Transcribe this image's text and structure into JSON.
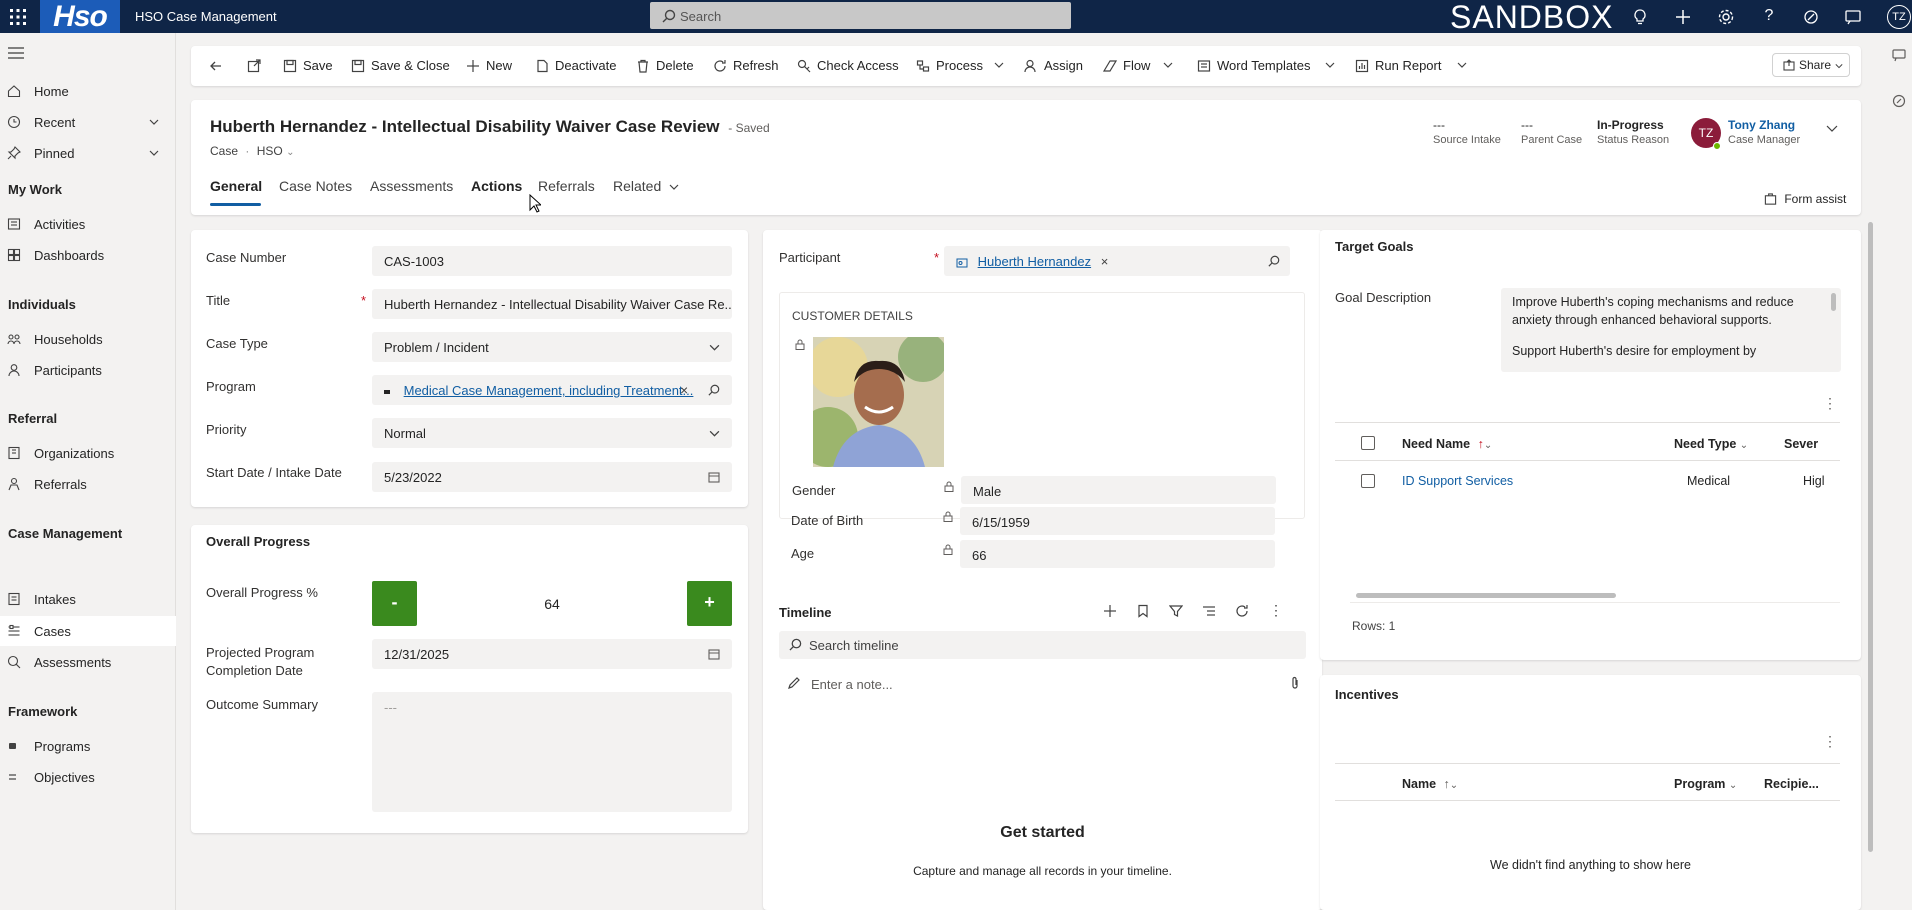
{
  "topbar": {
    "logo": "Hso",
    "app_name": "HSO Case Management",
    "search_placeholder": "Search",
    "environment": "SANDBOX",
    "avatar": "TZ"
  },
  "sidebar": {
    "items_top": [
      {
        "label": "Home",
        "icon": "home-icon"
      },
      {
        "label": "Recent",
        "icon": "clock-icon"
      },
      {
        "label": "Pinned",
        "icon": "pin-icon"
      }
    ],
    "sections": [
      {
        "title": "My Work",
        "items": [
          {
            "label": "Activities",
            "icon": "activities-icon"
          },
          {
            "label": "Dashboards",
            "icon": "dashboard-icon"
          }
        ]
      },
      {
        "title": "Individuals",
        "items": [
          {
            "label": "Households",
            "icon": "households-icon"
          },
          {
            "label": "Participants",
            "icon": "person-icon"
          }
        ]
      },
      {
        "title": "Referral",
        "items": [
          {
            "label": "Organizations",
            "icon": "organizations-icon"
          },
          {
            "label": "Referrals",
            "icon": "referrals-icon"
          }
        ]
      },
      {
        "title": "Case Management",
        "items": [
          {
            "label": "Intakes",
            "icon": "intakes-icon"
          },
          {
            "label": "Cases",
            "icon": "cases-icon"
          },
          {
            "label": "Assessments",
            "icon": "assessments-icon"
          }
        ]
      },
      {
        "title": "Framework",
        "items": [
          {
            "label": "Programs",
            "icon": "programs-icon"
          },
          {
            "label": "Objectives",
            "icon": "objectives-icon"
          }
        ]
      }
    ]
  },
  "commandbar": {
    "save": "Save",
    "save_close": "Save & Close",
    "new": "New",
    "deactivate": "Deactivate",
    "delete": "Delete",
    "refresh": "Refresh",
    "check_access": "Check Access",
    "process": "Process",
    "assign": "Assign",
    "flow": "Flow",
    "word_templates": "Word Templates",
    "run_report": "Run Report",
    "share": "Share"
  },
  "header": {
    "title": "Huberth Hernandez - Intellectual Disability Waiver Case Review",
    "save_status": "- Saved",
    "entity": "Case",
    "form": "HSO",
    "source_intake_value": "---",
    "source_intake_label": "Source Intake",
    "parent_case_value": "---",
    "parent_case_label": "Parent Case",
    "status_reason_value": "In-Progress",
    "status_reason_label": "Status Reason",
    "owner_initials": "TZ",
    "owner_name": "Tony Zhang",
    "owner_role": "Case Manager",
    "tabs": [
      "General",
      "Case Notes",
      "Assessments",
      "Actions",
      "Referrals",
      "Related"
    ],
    "form_assist": "Form assist"
  },
  "case_fields": {
    "case_number_label": "Case Number",
    "case_number": "CAS-1003",
    "title_label": "Title",
    "title": "Huberth Hernandez - Intellectual Disability Waiver Case Re...",
    "case_type_label": "Case Type",
    "case_type": "Problem / Incident",
    "program_label": "Program",
    "program": "Medical Case Management, including Treatment...",
    "priority_label": "Priority",
    "priority": "Normal",
    "start_date_label": "Start Date / Intake Date",
    "start_date": "5/23/2022"
  },
  "progress": {
    "section_title": "Overall Progress",
    "percent_label": "Overall Progress %",
    "minus": "-",
    "plus": "+",
    "value": "64",
    "projected_label_1": "Projected Program",
    "projected_label_2": "Completion Date",
    "projected_date": "12/31/2025",
    "outcome_label": "Outcome Summary",
    "outcome_placeholder": "---"
  },
  "participant": {
    "label": "Participant",
    "value": "Huberth Hernandez",
    "customer_details": "CUSTOMER DETAILS",
    "gender_label": "Gender",
    "gender": "Male",
    "dob_label": "Date of Birth",
    "dob": "6/15/1959",
    "age_label": "Age",
    "age": "66"
  },
  "timeline": {
    "title": "Timeline",
    "search_placeholder": "Search timeline",
    "note_placeholder": "Enter a note...",
    "empty_title": "Get started",
    "empty_text": "Capture and manage all records in your timeline."
  },
  "goals": {
    "title": "Target Goals",
    "goal_label": "Goal Description",
    "goal_text_1": "Improve Huberth's coping mechanisms and reduce anxiety through enhanced behavioral supports.",
    "goal_text_2": "Support Huberth's desire for employment by",
    "col_need_name": "Need Name",
    "col_need_type": "Need Type",
    "col_severity": "Sever",
    "row_need_name": "ID Support Services",
    "row_need_type": "Medical",
    "row_severity": "Higl",
    "rows": "Rows: 1"
  },
  "incentives": {
    "title": "Incentives",
    "col_name": "Name",
    "col_program": "Program",
    "col_recipient": "Recipie...",
    "empty": "We didn't find anything to show here"
  },
  "colors": {
    "topbar": "#0f2547",
    "logo": "#1c5cb8",
    "progress_button": "#3a8a1e",
    "avatar": "#8b1c3a",
    "link": "#115ea3"
  }
}
